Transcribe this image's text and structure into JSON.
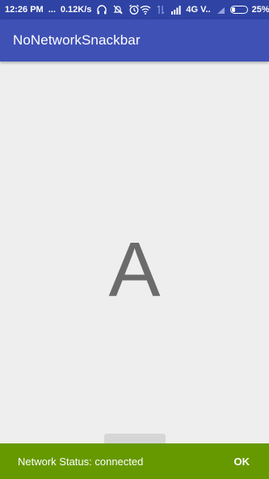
{
  "status_bar": {
    "time": "12:26 PM",
    "dots": "...",
    "speed": "0.12K/s",
    "network_type": "4G V..",
    "battery_percent": "25%",
    "battery_level": 0.25,
    "icons": [
      "headphones-icon",
      "mute-icon",
      "alarm-icon",
      "wifi-icon",
      "data-arrows-icon",
      "signal-icon",
      "signal-small-icon",
      "battery-icon"
    ]
  },
  "app_bar": {
    "title": "NoNetworkSnackbar",
    "color": "#3f51b5"
  },
  "main": {
    "letter": "A"
  },
  "snackbar": {
    "message": "Network Status: connected",
    "action": "OK",
    "color": "#669900"
  }
}
